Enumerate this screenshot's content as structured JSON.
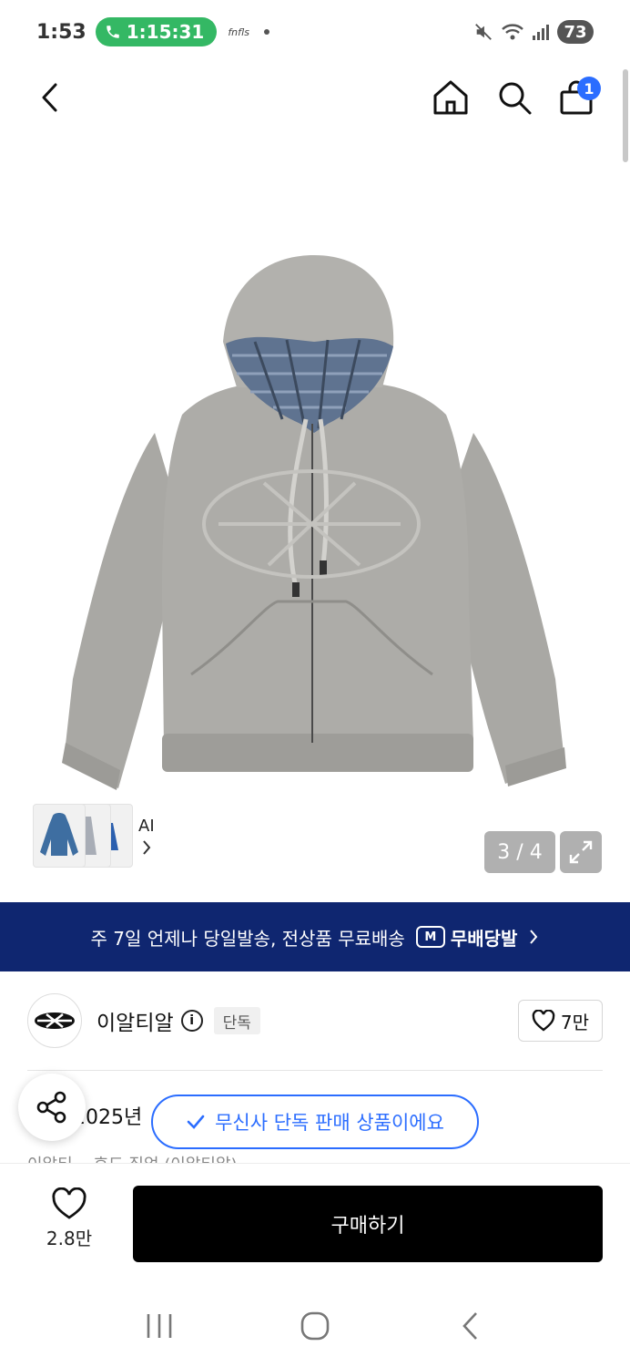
{
  "status_bar": {
    "time": "1:53",
    "call_duration": "1:15:31",
    "small_app": "fnfls",
    "battery": "73"
  },
  "header": {
    "cart_count": "1"
  },
  "gallery": {
    "ai_label": "AI",
    "counter": "3 / 4"
  },
  "banner": {
    "text": "주 7일 언제나 당일발송, 전상품 무료배송",
    "logo_text": "무배당발",
    "logo_mark": "M"
  },
  "brand": {
    "name": "이알티알",
    "exclusive_tag": "단독",
    "likes": "7만"
  },
  "product": {
    "title_partial": "2025년",
    "subtitle_partial": "이알티... 후드 집업 (이알티알)"
  },
  "toast": {
    "text": "무신사 단독 판매 상품이에요"
  },
  "bottom_bar": {
    "wish_count": "2.8만",
    "buy_label": "구매하기"
  },
  "colors": {
    "accent": "#2b6dff",
    "banner_bg": "#0f2670",
    "call_green": "#34b864",
    "buy_bg": "#000000"
  }
}
